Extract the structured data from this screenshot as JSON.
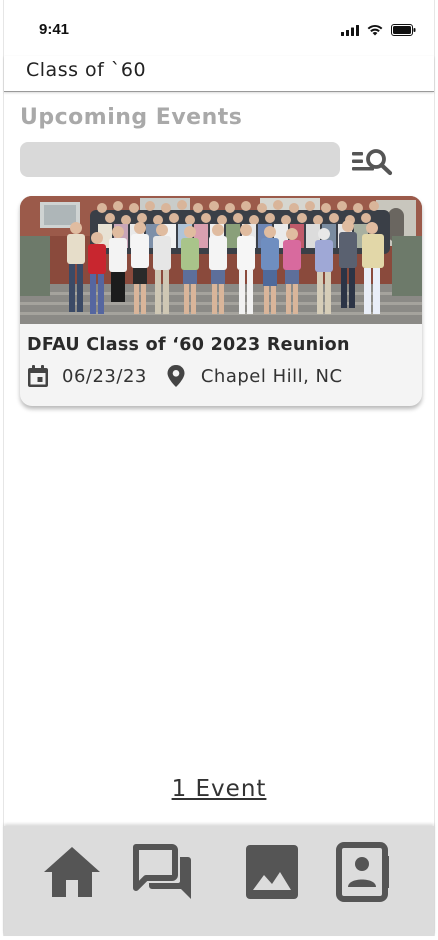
{
  "status_bar": {
    "time": "9:41"
  },
  "header": {
    "title": "Class of `60"
  },
  "section": {
    "title": "Upcoming Events"
  },
  "search": {
    "value": "",
    "placeholder": ""
  },
  "events": [
    {
      "title": "DFAU Class of ‘60 2023 Reunion",
      "date": "06/23/23",
      "location": "Chapel Hill, NC"
    }
  ],
  "events_count_label": "1 Event",
  "bottom_nav": [
    {
      "name": "home",
      "icon": "home-icon"
    },
    {
      "name": "messages",
      "icon": "forum-icon"
    },
    {
      "name": "photos",
      "icon": "image-icon"
    },
    {
      "name": "directory",
      "icon": "contact-book-icon"
    }
  ],
  "colors": {
    "nav_background": "#dcdcdc",
    "icon_gray": "#555555",
    "heading_gray": "#a9a9a9",
    "search_gray": "#d9d9d9"
  }
}
